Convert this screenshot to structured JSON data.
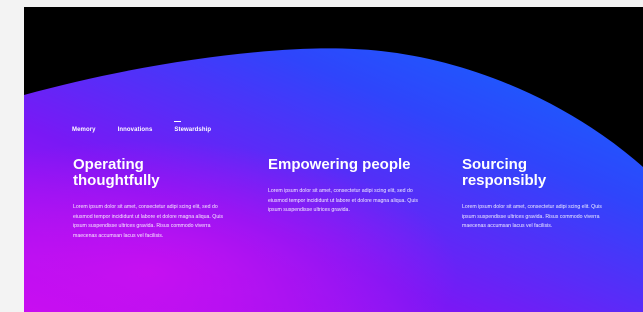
{
  "nav": {
    "items": [
      {
        "label": "Memory"
      },
      {
        "label": "Innovations"
      },
      {
        "label": "Stewardship"
      }
    ]
  },
  "columns": [
    {
      "title": "Operating thoughtfully",
      "body": "Lorem ipsum dolor sit amet, consectetur adipi scing elit, sed do eiusmod tempor incididunt ut labore et dolore magna aliqua. Quis ipsum suspendisse ultrices gravida. Risus commodo viverra maecenas accumsan lacus vel facilisis."
    },
    {
      "title": "Empowering people",
      "body": "Lorem ipsum dolor sit amet, consectetur adipi scing elit, sed do eiusmod tempor incididunt ut labore et dolore magna aliqua. Quis ipsum suspendisse ultrices gravida."
    },
    {
      "title": "Sourcing responsibly",
      "body": "Lorem ipsum dolor sit amet, consectetur adipi scing elit. Quis ipsum suspendisse ultrices gravida. Risus commodo viverra maecenas accumsan lacus vel facilisis."
    }
  ],
  "colors": {
    "background": "#000000",
    "gradient_start": "#c40cf2",
    "gradient_mid": "#6a1cf6",
    "gradient_end": "#1a5cff",
    "page": "#f3f3f3",
    "text": "#ffffff"
  }
}
